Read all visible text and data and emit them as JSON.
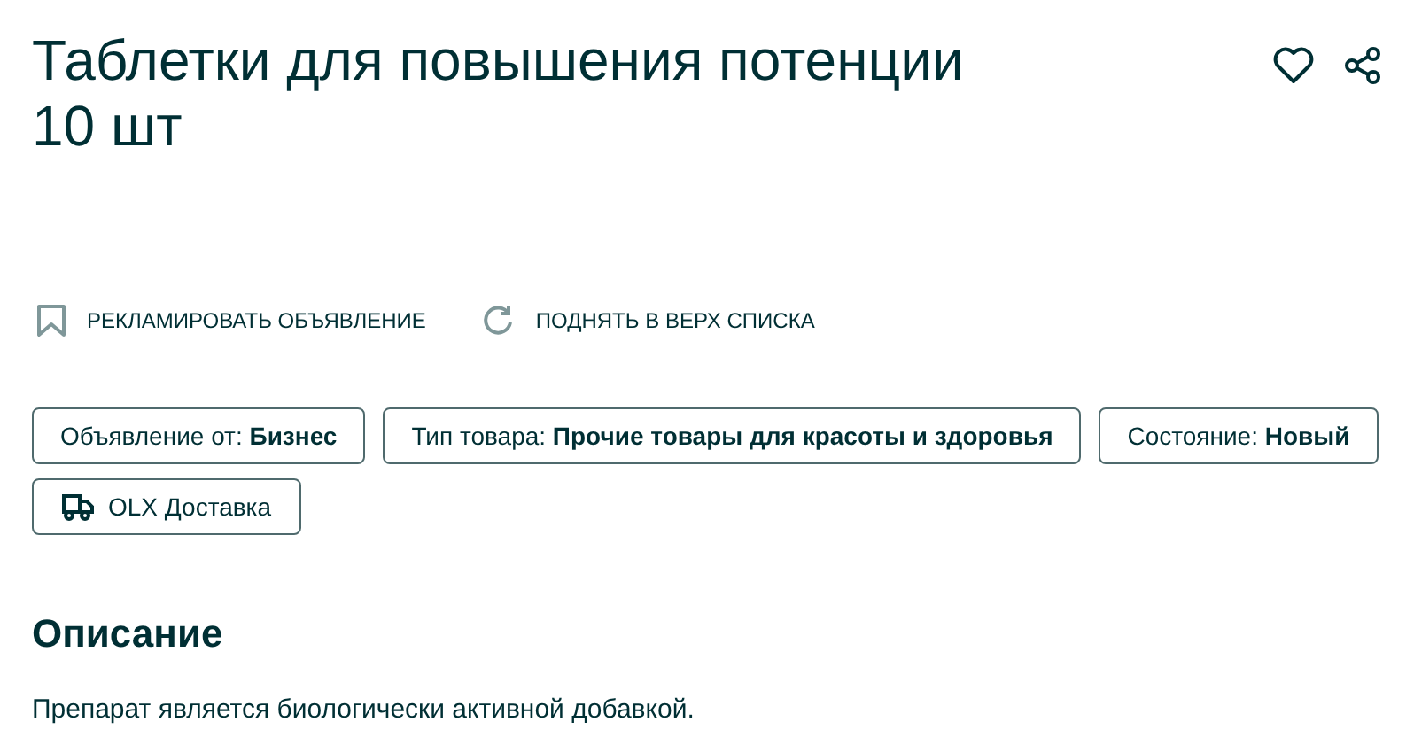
{
  "title": "Таблетки для повышения потенции 10 шт",
  "actions": [
    {
      "kind": "promote",
      "label": "РЕКЛАМИРОВАТЬ ОБЪЯВЛЕНИЕ"
    },
    {
      "kind": "refresh",
      "label": "ПОДНЯТЬ В ВЕРХ СПИСКА"
    }
  ],
  "tags": [
    {
      "kind": "param",
      "text": "Объявление от: **Бизнес**"
    },
    {
      "kind": "param",
      "text": "Тип товара: **Прочие товары для красоты и здоровья**"
    },
    {
      "kind": "param",
      "text": "Состояние: **Новый**"
    },
    {
      "kind": "delivery",
      "text": "OLX Доставка"
    }
  ],
  "description": {
    "heading": "Описание",
    "text": "Препарат является биологически активной добавкой."
  }
}
